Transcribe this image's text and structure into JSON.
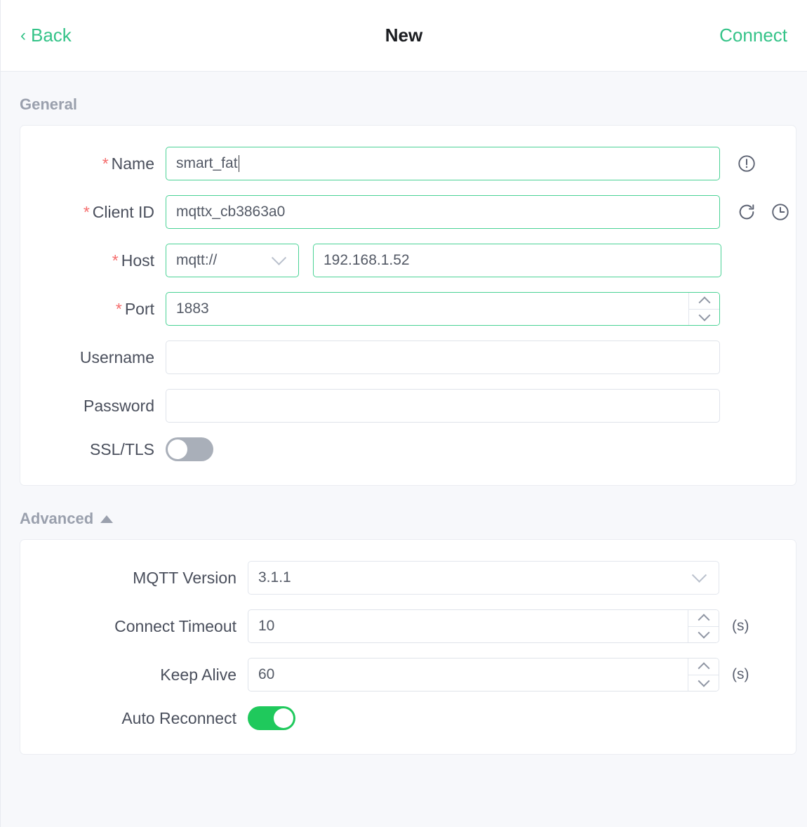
{
  "header": {
    "back_label": "Back",
    "title": "New",
    "connect_label": "Connect",
    "accent_color": "#34c388"
  },
  "general": {
    "section_label": "General",
    "rows": {
      "name": {
        "label": "Name",
        "required_mark": "*",
        "value": "smart_fat",
        "placeholder": "",
        "icon": "exclamation-circle-icon"
      },
      "client_id": {
        "label": "Client ID",
        "required_mark": "*",
        "value": "mqttx_cb3863a0",
        "placeholder": "",
        "icons": [
          "refresh-icon",
          "clock-icon"
        ]
      },
      "host": {
        "label": "Host",
        "required_mark": "*",
        "protocol": "mqtt://",
        "value": "192.168.1.52",
        "placeholder": ""
      },
      "port": {
        "label": "Port",
        "required_mark": "*",
        "value": "1883",
        "placeholder": ""
      },
      "username": {
        "label": "Username",
        "value": "",
        "placeholder": ""
      },
      "password": {
        "label": "Password",
        "value": "",
        "placeholder": ""
      },
      "ssl_tls": {
        "label": "SSL/TLS",
        "enabled": false
      }
    }
  },
  "advanced": {
    "section_label": "Advanced",
    "collapse_icon": "caret-up-icon",
    "expanded": true,
    "rows": {
      "mqtt_version": {
        "label": "MQTT Version",
        "value": "3.1.1"
      },
      "connect_timeout": {
        "label": "Connect Timeout",
        "value": "10",
        "suffix": "(s)"
      },
      "keep_alive": {
        "label": "Keep Alive",
        "value": "60",
        "suffix": "(s)"
      },
      "auto_reconnect": {
        "label": "Auto Reconnect",
        "enabled": true
      }
    }
  },
  "colors": {
    "accent_green": "#34c388",
    "field_border_active": "#4ad295",
    "toggle_on": "#1fc95c",
    "toggle_off": "#a9afb9",
    "required_red": "#f56c6c",
    "page_bg": "#f7f8fb"
  }
}
